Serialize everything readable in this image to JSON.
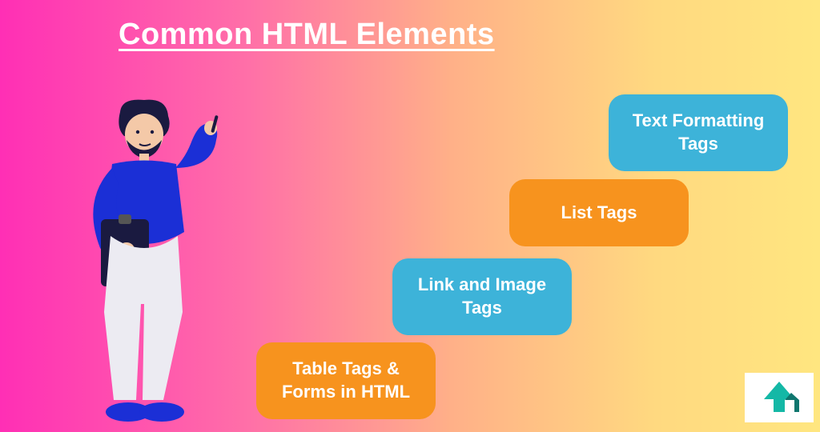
{
  "title": "Common HTML Elements",
  "cards": {
    "c1": "Table Tags & Forms in HTML",
    "c2": "Link and Image Tags",
    "c3": "List Tags",
    "c4": "Text Formatting Tags"
  },
  "colors": {
    "blue": "#3db3d9",
    "orange": "#f7931e"
  }
}
